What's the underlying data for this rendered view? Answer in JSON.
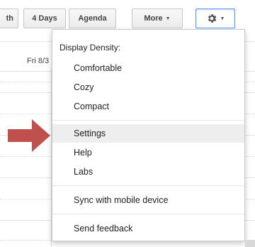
{
  "toolbar": {
    "month_label": "th",
    "four_days_label": "4 Days",
    "agenda_label": "Agenda",
    "more_label": "More",
    "caret_glyph": "▼"
  },
  "calendar": {
    "day_header": "Fri 8/3"
  },
  "settings_menu": {
    "density_header": "Display Density:",
    "items": [
      {
        "label": "Comfortable"
      },
      {
        "label": "Cozy"
      },
      {
        "label": "Compact"
      },
      {
        "label": "Settings",
        "highlighted": true
      },
      {
        "label": "Help"
      },
      {
        "label": "Labs"
      },
      {
        "label": "Sync with mobile device"
      },
      {
        "label": "Send feedback"
      }
    ]
  },
  "colors": {
    "arrow": "#c0504d",
    "focus_border": "#4d90fe",
    "hover_row": "#eeeeee"
  },
  "icons": {
    "settings": "gear-icon",
    "pointer": "right-arrow-icon"
  }
}
